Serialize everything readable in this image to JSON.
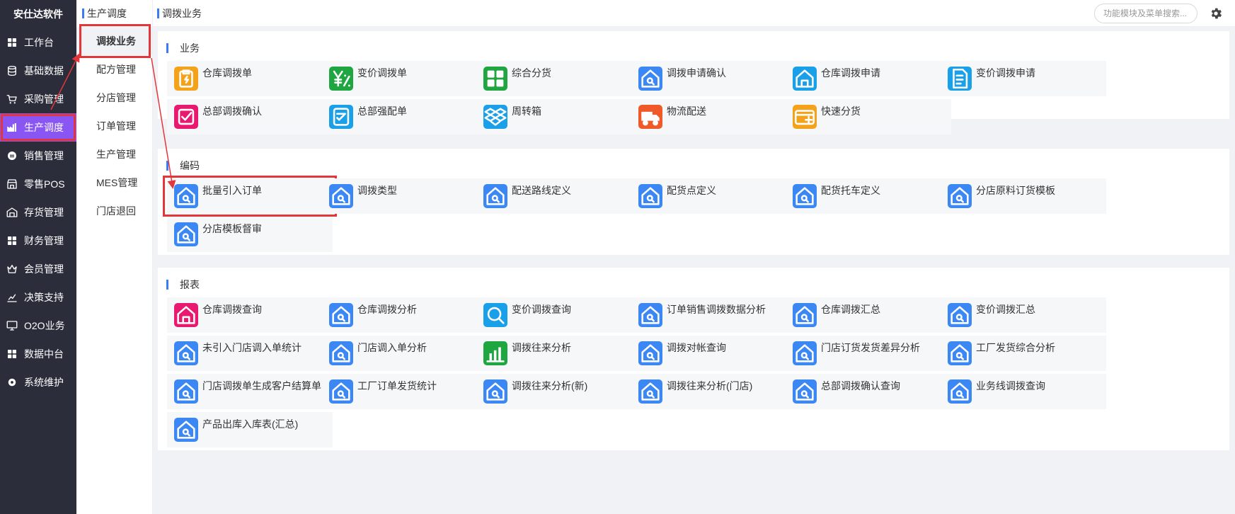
{
  "sidebar": {
    "brand": "安仕达软件",
    "items": [
      {
        "label": "工作台",
        "icon": "grid-icon"
      },
      {
        "label": "基础数据",
        "icon": "database-icon"
      },
      {
        "label": "采购管理",
        "icon": "cart-icon"
      },
      {
        "label": "生产调度",
        "icon": "factory-icon",
        "active": true
      },
      {
        "label": "销售管理",
        "icon": "sales-icon"
      },
      {
        "label": "零售POS",
        "icon": "store-icon"
      },
      {
        "label": "存货管理",
        "icon": "warehouse-icon"
      },
      {
        "label": "财务管理",
        "icon": "grid-icon"
      },
      {
        "label": "会员管理",
        "icon": "crown-icon"
      },
      {
        "label": "决策支持",
        "icon": "chart-icon"
      },
      {
        "label": "O2O业务",
        "icon": "monitor-icon"
      },
      {
        "label": "数据中台",
        "icon": "grid-icon"
      },
      {
        "label": "系统维护",
        "icon": "gear-icon"
      }
    ]
  },
  "submenu": {
    "title": "生产调度",
    "items": [
      {
        "label": "调拨业务",
        "active": true
      },
      {
        "label": "配方管理"
      },
      {
        "label": "分店管理"
      },
      {
        "label": "订单管理"
      },
      {
        "label": "生产管理"
      },
      {
        "label": "MES管理"
      },
      {
        "label": "门店退回"
      }
    ]
  },
  "header": {
    "title": "调拨业务",
    "search_placeholder": "功能模块及菜单搜索..."
  },
  "sections": [
    {
      "title": "业务",
      "tiles": [
        {
          "label": "仓库调拨单",
          "icon": "clipboard-icon",
          "color": "#f5a21b"
        },
        {
          "label": "变价调拨单",
          "icon": "yen-price-icon",
          "color": "#20a640"
        },
        {
          "label": "综合分货",
          "icon": "grid-icon",
          "color": "#20a640"
        },
        {
          "label": "调拨申请确认",
          "icon": "house-search-icon",
          "color": "#3b88f5"
        },
        {
          "label": "仓库调拨申请",
          "icon": "house-icon",
          "color": "#1aa0e8"
        },
        {
          "label": "变价调拨申请",
          "icon": "document-icon",
          "color": "#1aa0e8"
        },
        {
          "label": "总部调拨确认",
          "icon": "check-box-icon",
          "color": "#e8196f"
        },
        {
          "label": "总部强配单",
          "icon": "checklist-icon",
          "color": "#1aa0e8"
        },
        {
          "label": "周转箱",
          "icon": "dropbox-icon",
          "color": "#1aa0e8"
        },
        {
          "label": "物流配送",
          "icon": "truck-icon",
          "color": "#f05a28"
        },
        {
          "label": "快速分货",
          "icon": "card-icon",
          "color": "#f5a21b"
        }
      ]
    },
    {
      "title": "编码",
      "tiles": [
        {
          "label": "批量引入订单",
          "icon": "house-search-icon",
          "color": "#3b88f5",
          "highlight": true
        },
        {
          "label": "调拨类型",
          "icon": "house-search-icon",
          "color": "#3b88f5"
        },
        {
          "label": "配送路线定义",
          "icon": "house-search-icon",
          "color": "#3b88f5"
        },
        {
          "label": "配货点定义",
          "icon": "house-search-icon",
          "color": "#3b88f5"
        },
        {
          "label": "配货托车定义",
          "icon": "house-search-icon",
          "color": "#3b88f5"
        },
        {
          "label": "分店原料订货模板",
          "icon": "house-search-icon",
          "color": "#3b88f5"
        },
        {
          "label": "分店模板督审",
          "icon": "house-search-icon",
          "color": "#3b88f5"
        }
      ]
    },
    {
      "title": "报表",
      "tiles": [
        {
          "label": "仓库调拨查询",
          "icon": "house-icon",
          "color": "#e8196f"
        },
        {
          "label": "仓库调拨分析",
          "icon": "house-search-icon",
          "color": "#3b88f5"
        },
        {
          "label": "变价调拨查询",
          "icon": "magnifier-icon",
          "color": "#1aa0e8"
        },
        {
          "label": "订单销售调拨数据分析",
          "icon": "house-search-icon",
          "color": "#3b88f5"
        },
        {
          "label": "仓库调拨汇总",
          "icon": "house-search-icon",
          "color": "#3b88f5"
        },
        {
          "label": "变价调拨汇总",
          "icon": "house-search-icon",
          "color": "#3b88f5"
        },
        {
          "label": "未引入门店调入单统计",
          "icon": "house-search-icon",
          "color": "#3b88f5"
        },
        {
          "label": "门店调入单分析",
          "icon": "house-search-icon",
          "color": "#3b88f5"
        },
        {
          "label": "调拨往来分析",
          "icon": "bar-chart-icon",
          "color": "#20a640"
        },
        {
          "label": "调拨对帐查询",
          "icon": "house-search-icon",
          "color": "#3b88f5"
        },
        {
          "label": "门店订货发货差异分析",
          "icon": "house-search-icon",
          "color": "#3b88f5"
        },
        {
          "label": "工厂发货综合分析",
          "icon": "house-search-icon",
          "color": "#3b88f5"
        },
        {
          "label": "门店调拨单生成客户结算单",
          "icon": "house-search-icon",
          "color": "#3b88f5"
        },
        {
          "label": "工厂订单发货统计",
          "icon": "house-search-icon",
          "color": "#3b88f5"
        },
        {
          "label": "调拨往来分析(新)",
          "icon": "house-search-icon",
          "color": "#3b88f5"
        },
        {
          "label": "调拨往来分析(门店)",
          "icon": "house-search-icon",
          "color": "#3b88f5"
        },
        {
          "label": "总部调拨确认查询",
          "icon": "house-search-icon",
          "color": "#3b88f5"
        },
        {
          "label": "业务线调拨查询",
          "icon": "house-search-icon",
          "color": "#3b88f5"
        },
        {
          "label": "产品出库入库表(汇总)",
          "icon": "house-search-icon",
          "color": "#3b88f5"
        }
      ]
    }
  ]
}
